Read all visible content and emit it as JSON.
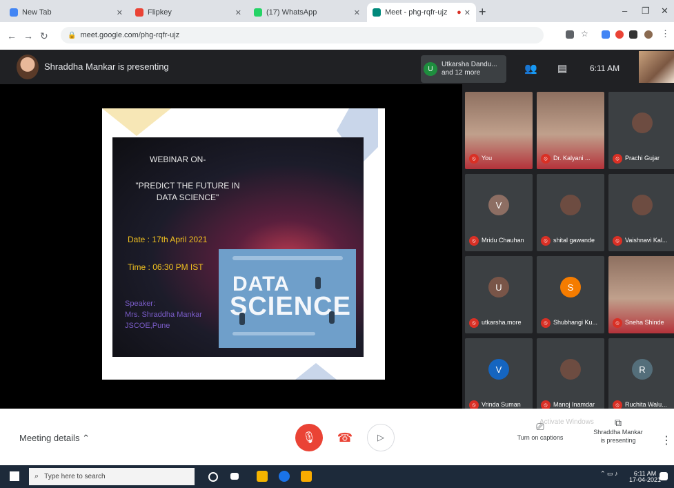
{
  "browser": {
    "tabs": [
      {
        "label": "New Tab",
        "active": false,
        "color": "#4285f4"
      },
      {
        "label": "Flipkey",
        "active": false,
        "color": "#ea4335"
      },
      {
        "label": "(17) WhatsApp",
        "active": false,
        "color": "#25d366"
      },
      {
        "label": "Meet - phg-rqfr-ujz",
        "active": true,
        "color": "#00897b"
      }
    ],
    "url": "meet.google.com/phg-rqfr-ujz"
  },
  "meet": {
    "presenting_text": "Shraddha Mankar is presenting",
    "others_line1": "Utkarsha Dandu...",
    "others_line2": "and 12 more",
    "time": "6:11 AM",
    "slide": {
      "title": "WEBINAR ON-",
      "subtitle_line1": "\"PREDICT THE FUTURE IN",
      "subtitle_line2": "DATA SCIENCE\"",
      "date": "Date : 17th April 2021",
      "time": "Time : 06:30 PM IST",
      "speaker_line1": "Speaker:",
      "speaker_line2": "Mrs. Shraddha Mankar",
      "speaker_line3": "JSCOE,Pune"
    },
    "card": {
      "line1": "DATA",
      "line2": "SCIENCE"
    },
    "participants": [
      {
        "name": "You",
        "video": true,
        "initial": "",
        "color": ""
      },
      {
        "name": "Dr. Kalyani ...",
        "video": true,
        "initial": "",
        "color": ""
      },
      {
        "name": "Prachi Gujar",
        "video": false,
        "initial": "",
        "color": "#6d4c41"
      },
      {
        "name": "Mridu Chauhan",
        "video": false,
        "initial": "V",
        "color": "#8d6e63"
      },
      {
        "name": "shital gawande",
        "video": false,
        "initial": "",
        "color": "#6d4c41"
      },
      {
        "name": "Vaishnavi Kal...",
        "video": false,
        "initial": "",
        "color": "#6d4c41"
      },
      {
        "name": "utkarsha.more",
        "video": false,
        "initial": "U",
        "color": "#795548"
      },
      {
        "name": "Shubhangi Ku...",
        "video": false,
        "initial": "S",
        "color": "#f57c00"
      },
      {
        "name": "Sneha Shinde",
        "video": true,
        "initial": "",
        "color": ""
      },
      {
        "name": "Vrinda Suman",
        "video": false,
        "initial": "V",
        "color": "#1565c0"
      },
      {
        "name": "Manoj Inamdar",
        "video": false,
        "initial": "",
        "color": "#6d4c41"
      },
      {
        "name": "Ruchita Walu...",
        "video": false,
        "initial": "R",
        "color": "#546e7a"
      }
    ],
    "bottom": {
      "meeting_details": "Meeting details",
      "captions": "Turn on captions",
      "presenter_line1": "Shraddha Mankar",
      "presenter_line2": "is presenting",
      "activate": "Activate Windows"
    }
  },
  "taskbar": {
    "search_placeholder": "Type here to search",
    "time": "6:11 AM",
    "date": "17-04-2021"
  }
}
